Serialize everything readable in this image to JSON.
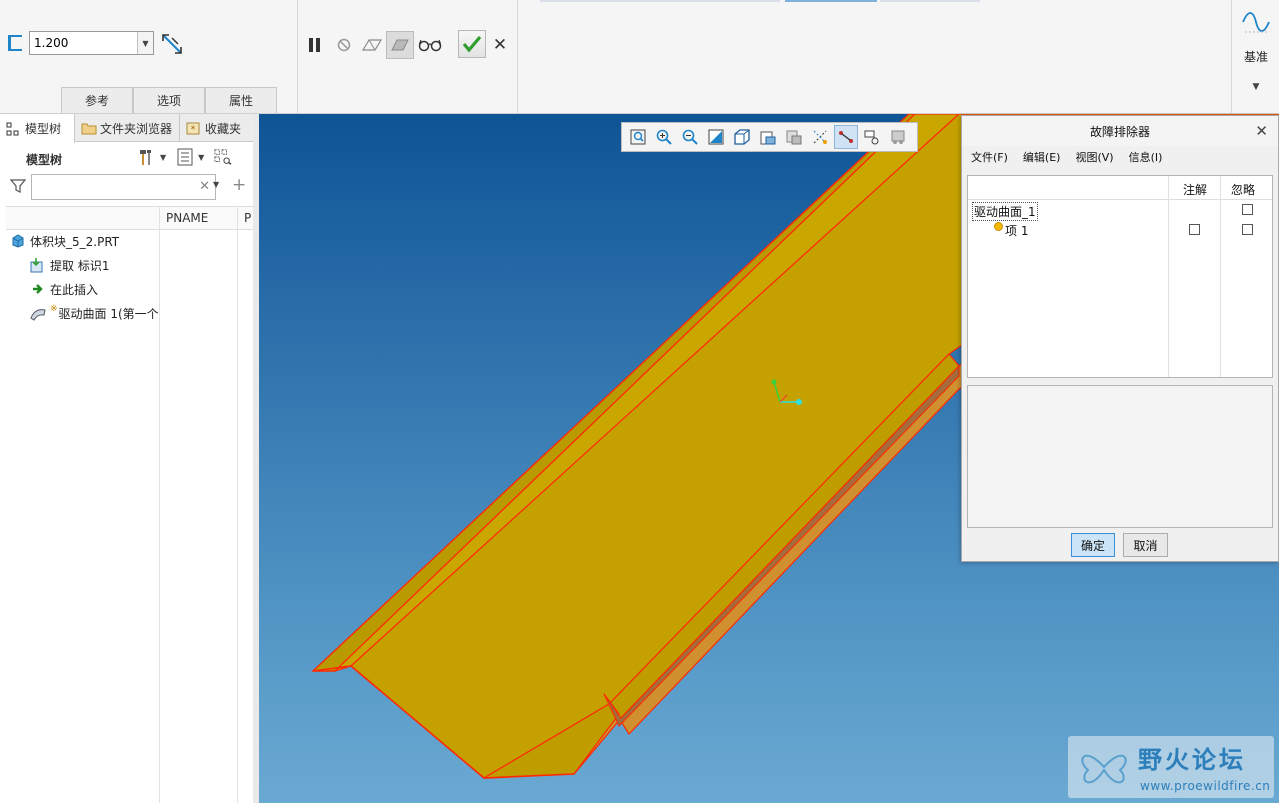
{
  "ribbon": {
    "thickness_value": "1.200",
    "tabs": [
      "参考",
      "选项",
      "属性"
    ],
    "datum_label": "基准",
    "colors": {
      "accent": "#1f84c8",
      "ok_green": "#2f9e2f"
    }
  },
  "model_tree": {
    "nav_tabs": [
      "模型树",
      "文件夹浏览器",
      "收藏夹"
    ],
    "title": "模型树",
    "columns": [
      "PNAME",
      "P"
    ],
    "items": [
      {
        "label": "体积块_5_2.PRT",
        "icon": "part-icon"
      },
      {
        "label": "提取 标识1",
        "icon": "extract-icon"
      },
      {
        "label": "在此插入",
        "icon": "insert-here-arrow-icon"
      },
      {
        "label": "驱动曲面 1(第一个",
        "icon": "driving-surface-icon"
      }
    ]
  },
  "viewport": {
    "toolbar_icons": [
      "refit-icon",
      "zoom-in-icon",
      "zoom-out-icon",
      "repaint-icon",
      "display-style-icon",
      "saved-orientations-icon",
      "view-manager-icon",
      "datum-display-icon",
      "spin-center-icon",
      "annotation-display-icon",
      "simulation-display-icon"
    ],
    "colors": {
      "model_face": "#c9a400",
      "edge": "#ff2a00",
      "background_top": "#0e5496",
      "background_bottom": "#6aa9d2"
    }
  },
  "troubleshooter": {
    "title": "故障排除器",
    "menu": [
      "文件(F)",
      "编辑(E)",
      "视图(V)",
      "信息(I)"
    ],
    "columns": [
      "注解",
      "忽略"
    ],
    "rows": [
      {
        "label": "驱动曲面_1",
        "annotate": null,
        "ignore": false
      },
      {
        "label": "项 1",
        "annotate": false,
        "ignore": false
      }
    ],
    "ok_label": "确定",
    "cancel_label": "取消"
  },
  "watermark": {
    "title": "野火论坛",
    "url": "www.proewildfire.cn"
  }
}
